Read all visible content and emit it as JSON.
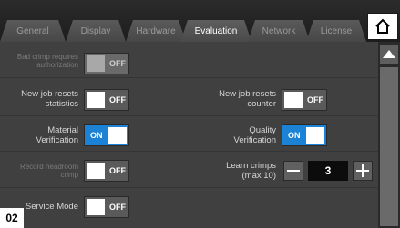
{
  "tabs": [
    {
      "label": "General",
      "active": false
    },
    {
      "label": "Display",
      "active": false
    },
    {
      "label": "Hardware",
      "active": false
    },
    {
      "label": "Evaluation",
      "active": true
    },
    {
      "label": "Network",
      "active": false
    },
    {
      "label": "License",
      "active": false
    }
  ],
  "home_icon": "home-icon",
  "settings": {
    "bad_crimp": {
      "label": "Bad crimp requires authorization",
      "state": "OFF",
      "enabled": false
    },
    "new_job_stats": {
      "label": "New job resets statistics",
      "state": "OFF",
      "enabled": true
    },
    "new_job_counter": {
      "label": "New job resets counter",
      "state": "OFF",
      "enabled": true
    },
    "material_verification": {
      "label": "Material Verification",
      "state": "ON",
      "enabled": true
    },
    "quality_verification": {
      "label": "Quality Verification",
      "state": "ON",
      "enabled": true
    },
    "record_headroom": {
      "label": "Record headroom crimp",
      "state": "OFF",
      "enabled": false
    },
    "learn_crimps": {
      "label": "Learn crimps (max 10)",
      "value": "3"
    },
    "service_mode": {
      "label": "Service Mode",
      "state": "OFF",
      "enabled": true
    }
  },
  "scroll_up_icon": "triangle-up-icon",
  "badge": "02",
  "colors": {
    "on": "#1b82d6",
    "off": "#5a5a5a"
  }
}
